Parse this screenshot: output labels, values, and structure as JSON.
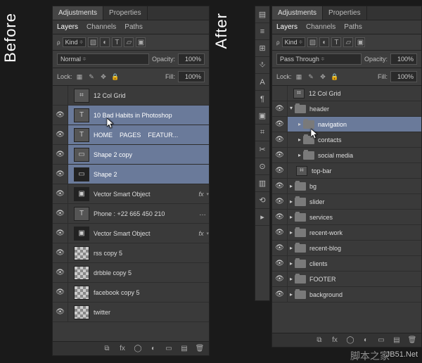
{
  "labels": {
    "before": "Before",
    "after": "After"
  },
  "tabs": {
    "adjustments": "Adjustments",
    "properties": "Properties",
    "layers": "Layers",
    "channels": "Channels",
    "paths": "Paths"
  },
  "kind": {
    "label": "Kind",
    "value": "⧉"
  },
  "blend": {
    "before": "Normal",
    "after": "Pass Through",
    "opacity_label": "Opacity:",
    "opacity_value": "100%"
  },
  "lock": {
    "label": "Lock:",
    "fill_label": "Fill:",
    "fill_value": "100%"
  },
  "before_layers": {
    "grid": "12 Col Grid",
    "title": "10 Bad Habits in Photoshop",
    "nav_home": "HOME",
    "nav_pages": "PAGES",
    "nav_featur": "FEATUR...",
    "shape2copy": "Shape 2 copy",
    "shape2": "Shape 2",
    "vso1": "Vector Smart Object",
    "phone": "Phone : +22 665 450 210",
    "vso2": "Vector Smart Object",
    "rss": "rss copy 5",
    "drbble": "drbble copy 5",
    "facebook": "facebook copy 5",
    "twitter": "twitter"
  },
  "after_layers": {
    "grid": "12 Col Grid",
    "header": "header",
    "navigation": "navigation",
    "contacts": "contacts",
    "social": "social media",
    "topbar": "top-bar",
    "bg": "bg",
    "slider": "slider",
    "services": "services",
    "recentwork": "recent-work",
    "recentblog": "recent-blog",
    "clients": "clients",
    "footer": "FOOTER",
    "background": "background"
  },
  "watermark": {
    "site": "JB51.Net",
    "cn": "脚本之家"
  }
}
